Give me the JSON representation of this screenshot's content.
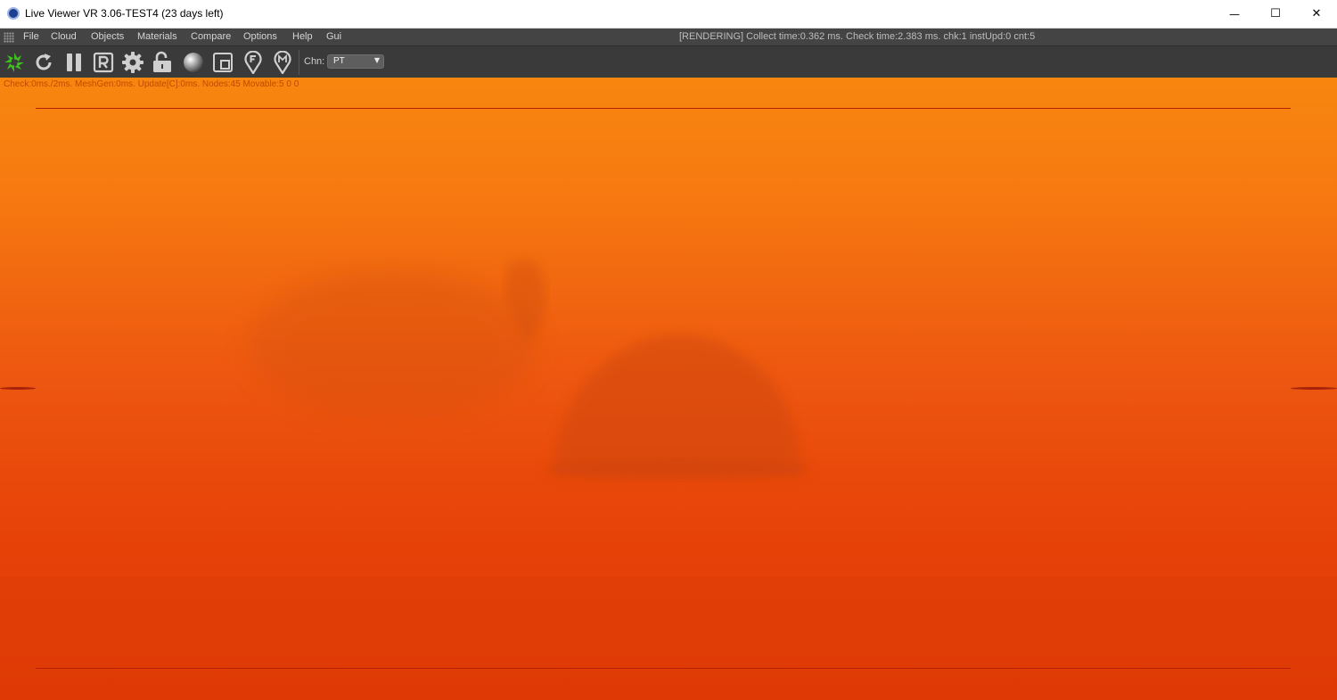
{
  "window": {
    "title": "Live Viewer VR 3.06-TEST4 (23 days left)",
    "minimize_glyph": "—",
    "maximize_glyph": "☐",
    "close_glyph": "✕"
  },
  "menu": {
    "items": [
      "File",
      "Cloud",
      "Objects",
      "Materials",
      "Compare",
      "Options",
      "Help",
      "Gui"
    ],
    "status": "[RENDERING] Collect time:0.362 ms.  Check time:2.383 ms.  chk:1  instUpd:0  cnt:5"
  },
  "toolbar": {
    "icons": [
      "start-render-icon",
      "restart-icon",
      "pause-icon",
      "r-icon",
      "settings-gear-icon",
      "lock-icon",
      "material-sphere-icon",
      "region-icon",
      "pin-f-icon",
      "pin-m-icon"
    ],
    "channel_label": "Chn:",
    "channel_value": "PT",
    "accent_color": "#3fbf1f"
  },
  "viewport": {
    "debug_text": "Check:0ms./2ms. MeshGen:0ms. Update[C]:0ms. Nodes:45 Movable:5  0 0",
    "fog_color_top": "#f7860f",
    "fog_color_bottom": "#e23a05"
  }
}
